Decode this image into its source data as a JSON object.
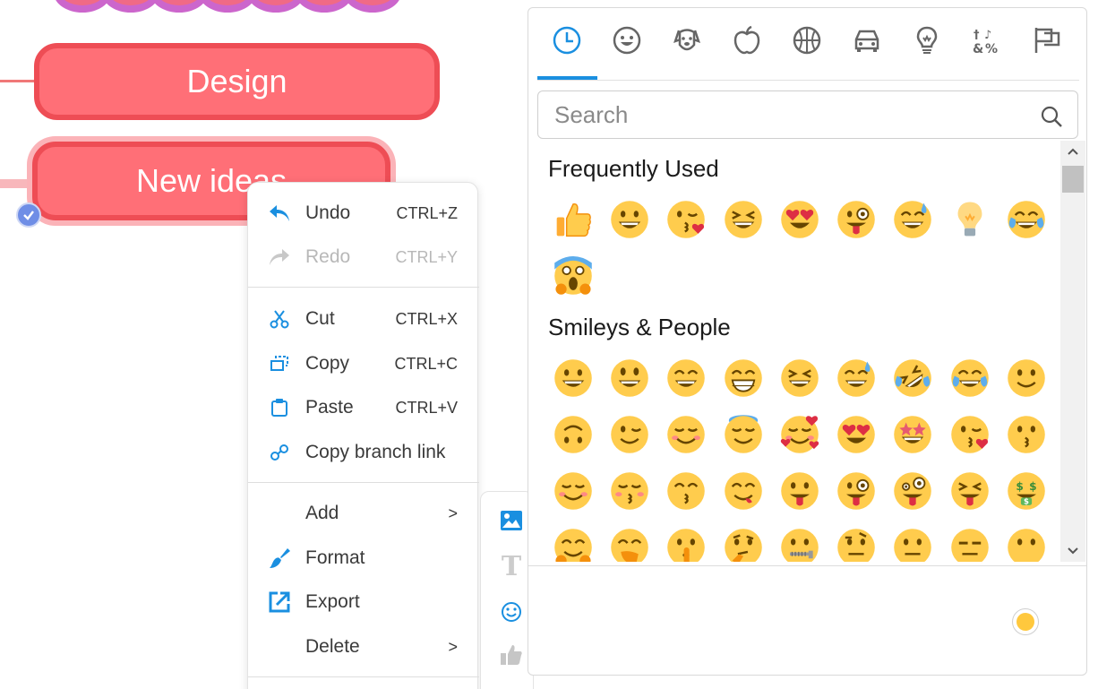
{
  "mindmap": {
    "nodes": [
      {
        "label": "Design"
      },
      {
        "label": "New ideas"
      }
    ],
    "colors": {
      "node_fill": "#ff6f77",
      "node_border": "#ee4d55",
      "selection_glow": "#fbb3b8"
    }
  },
  "context_menu": {
    "items": [
      {
        "label": "Undo",
        "shortcut": "CTRL+Z",
        "icon": "undo-icon",
        "enabled": true
      },
      {
        "label": "Redo",
        "shortcut": "CTRL+Y",
        "icon": "redo-icon",
        "enabled": false
      },
      {
        "label": "Cut",
        "shortcut": "CTRL+X",
        "icon": "scissors-icon",
        "enabled": true
      },
      {
        "label": "Copy",
        "shortcut": "CTRL+C",
        "icon": "copy-icon",
        "enabled": true
      },
      {
        "label": "Paste",
        "shortcut": "CTRL+V",
        "icon": "clipboard-icon",
        "enabled": true
      },
      {
        "label": "Copy branch link",
        "shortcut": "",
        "icon": "link-icon",
        "enabled": true
      },
      {
        "label": "Add",
        "shortcut": ">",
        "icon": "",
        "enabled": true
      },
      {
        "label": "Format",
        "shortcut": "",
        "icon": "paintbrush-icon",
        "enabled": true
      },
      {
        "label": "Export",
        "shortcut": "",
        "icon": "export-icon",
        "enabled": true
      },
      {
        "label": "Delete",
        "shortcut": ">",
        "icon": "",
        "enabled": true
      }
    ],
    "submenu_icons": [
      "image-icon",
      "text-icon",
      "emoji-icon",
      "thumbs-up-icon"
    ]
  },
  "emoji_picker": {
    "tabs": [
      "recent-icon",
      "smiley-icon",
      "dog-icon",
      "apple-icon",
      "basketball-icon",
      "car-icon",
      "lightbulb-icon",
      "symbols-icon",
      "flags-icon"
    ],
    "active_tab": "recent-icon",
    "search": {
      "value": "",
      "placeholder": "Search"
    },
    "categories": {
      "frequent": {
        "title": "Frequently Used",
        "emojis": [
          "thumbs-up",
          "grinning",
          "kissing-heart",
          "laughing",
          "heart-eyes",
          "winking-tongue",
          "sweat-smile",
          "bulb",
          "joy",
          "scream"
        ]
      },
      "smileys": {
        "title": "Smileys & People",
        "emojis": [
          "grinning",
          "smiley",
          "smile",
          "grin",
          "laughing",
          "sweat-smile",
          "rofl",
          "joy",
          "slight-smile",
          "upside-down",
          "wink",
          "blush",
          "innocent",
          "smiling-hearts",
          "heart-eyes",
          "star-struck",
          "kissing-heart",
          "kissing",
          "relaxed",
          "kissing-closed-eyes",
          "kissing-smiling-eyes",
          "yum",
          "tongue",
          "winking-tongue",
          "zany",
          "squinting-tongue",
          "money-mouth",
          "hugging",
          "hand-over-mouth",
          "shushing",
          "thinking",
          "zipper-mouth",
          "raised-eyebrow",
          "neutral",
          "expressionless",
          "no-mouth"
        ]
      }
    },
    "skin_tone_color": "#ffc83d",
    "accent": "#1a8fe0"
  }
}
